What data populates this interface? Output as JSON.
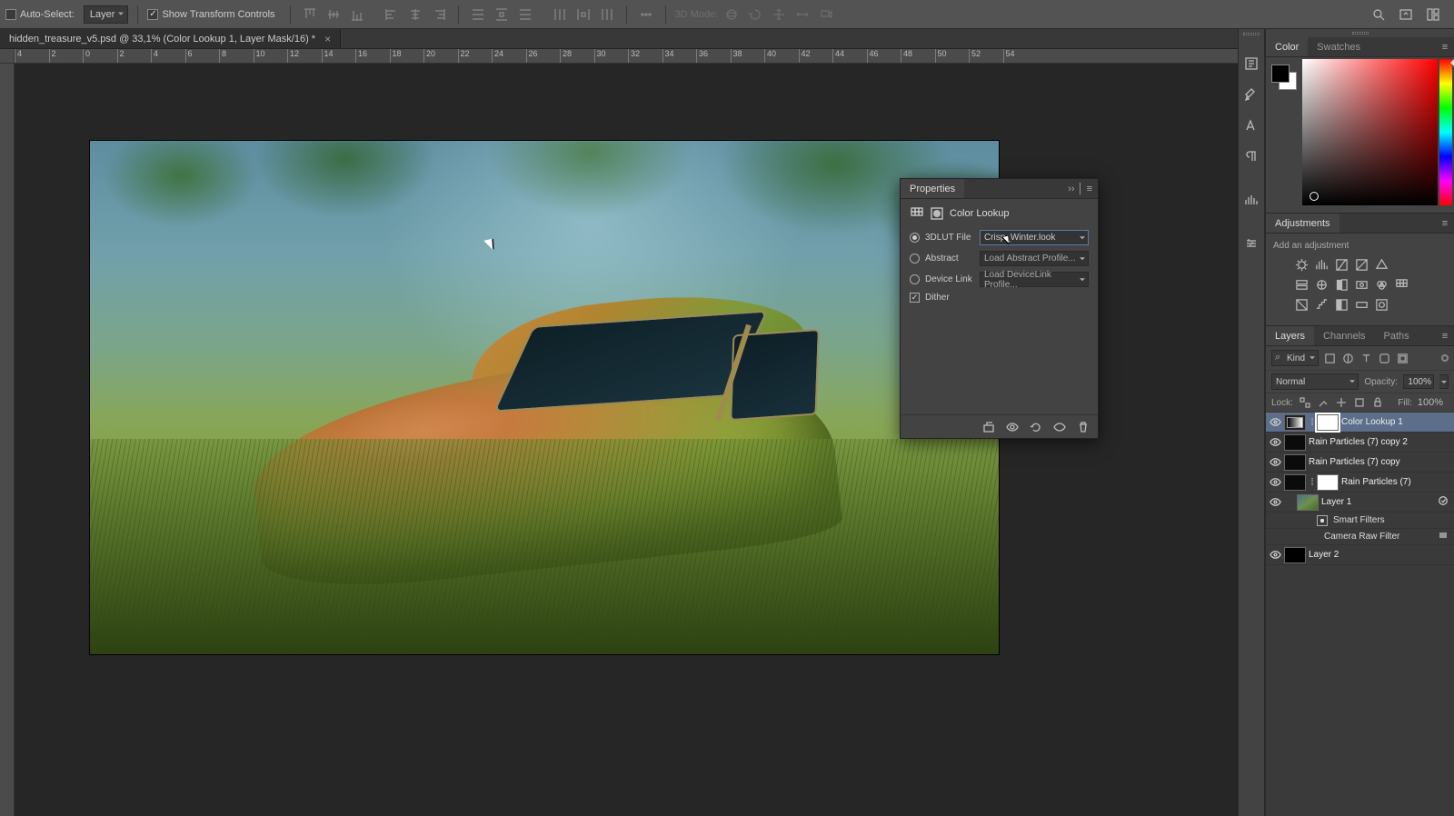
{
  "options_bar": {
    "auto_select_label": "Auto-Select:",
    "auto_select_checked": false,
    "target_dropdown": "Layer",
    "show_transform_label": "Show Transform Controls",
    "show_transform_checked": true,
    "three_d_mode_label": "3D Mode:"
  },
  "document": {
    "tab_title": "hidden_treasure_v5.psd @ 33,1% (Color Lookup 1, Layer Mask/16) *"
  },
  "ruler": {
    "marks": [
      "4",
      "2",
      "0",
      "2",
      "4",
      "6",
      "8",
      "10",
      "12",
      "14",
      "16",
      "18",
      "20",
      "22",
      "24",
      "26",
      "28",
      "30",
      "32",
      "34",
      "36",
      "38",
      "40",
      "42",
      "44",
      "46",
      "48",
      "50",
      "52",
      "54"
    ]
  },
  "color_panel": {
    "tabs": [
      "Color",
      "Swatches"
    ],
    "active": 0
  },
  "adjustments_panel": {
    "tab": "Adjustments",
    "hint": "Add an adjustment"
  },
  "layers_panel": {
    "tabs": [
      "Layers",
      "Channels",
      "Paths"
    ],
    "active": 0,
    "filter_kind": "Kind",
    "blend_mode": "Normal",
    "opacity_label": "Opacity:",
    "opacity_value": "100%",
    "lock_label": "Lock:",
    "fill_label": "Fill:",
    "fill_value": "100%",
    "layers": [
      {
        "name": "Color Lookup 1"
      },
      {
        "name": "Rain Particles (7) copy 2"
      },
      {
        "name": "Rain Particles (7) copy"
      },
      {
        "name": "Rain Particles (7)"
      },
      {
        "name": "Layer 1"
      },
      {
        "name": "Layer 2"
      }
    ],
    "smart_filters_label": "Smart Filters",
    "camera_raw_label": "Camera Raw Filter"
  },
  "properties_panel": {
    "tab": "Properties",
    "title": "Color Lookup",
    "rows": {
      "lut_label": "3DLUT File",
      "lut_value": "Crisp_Winter.look",
      "abstract_label": "Abstract",
      "abstract_value": "Load Abstract Profile...",
      "device_label": "Device Link",
      "device_value": "Load DeviceLink Profile...",
      "dither_label": "Dither"
    }
  }
}
